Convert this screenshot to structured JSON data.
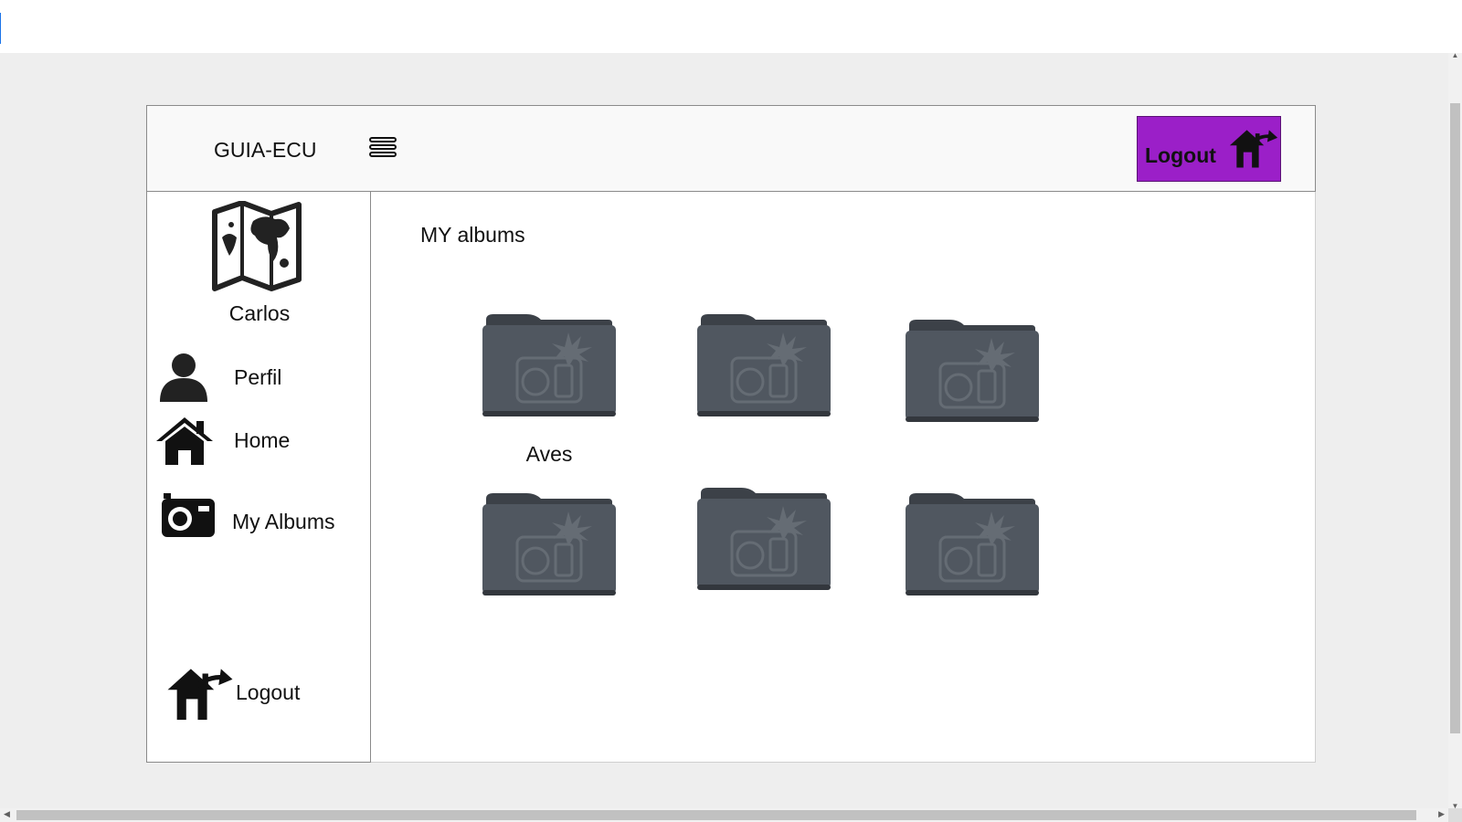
{
  "header": {
    "brand": "GUIA-ECU",
    "menu_icon": "hamburger-menu-icon",
    "logout_label": "Logout",
    "logout_icon": "house-exit-icon",
    "logout_color": "#9b1fc8"
  },
  "sidebar": {
    "logo_icon": "world-map-icon",
    "user_name": "Carlos",
    "items": [
      {
        "label": "Perfil",
        "icon": "user-icon"
      },
      {
        "label": "Home",
        "icon": "home-icon"
      },
      {
        "label": "My Albums",
        "icon": "camera-icon"
      }
    ],
    "logout_label": "Logout",
    "logout_icon": "house-exit-icon"
  },
  "main": {
    "title": "MY albums",
    "albums": [
      {
        "caption": "Aves",
        "icon": "photo-folder-icon"
      },
      {
        "caption": "",
        "icon": "photo-folder-icon"
      },
      {
        "caption": "",
        "icon": "photo-folder-icon"
      },
      {
        "caption": "",
        "icon": "photo-folder-icon"
      },
      {
        "caption": "",
        "icon": "photo-folder-icon"
      },
      {
        "caption": "",
        "icon": "photo-folder-icon"
      }
    ]
  }
}
